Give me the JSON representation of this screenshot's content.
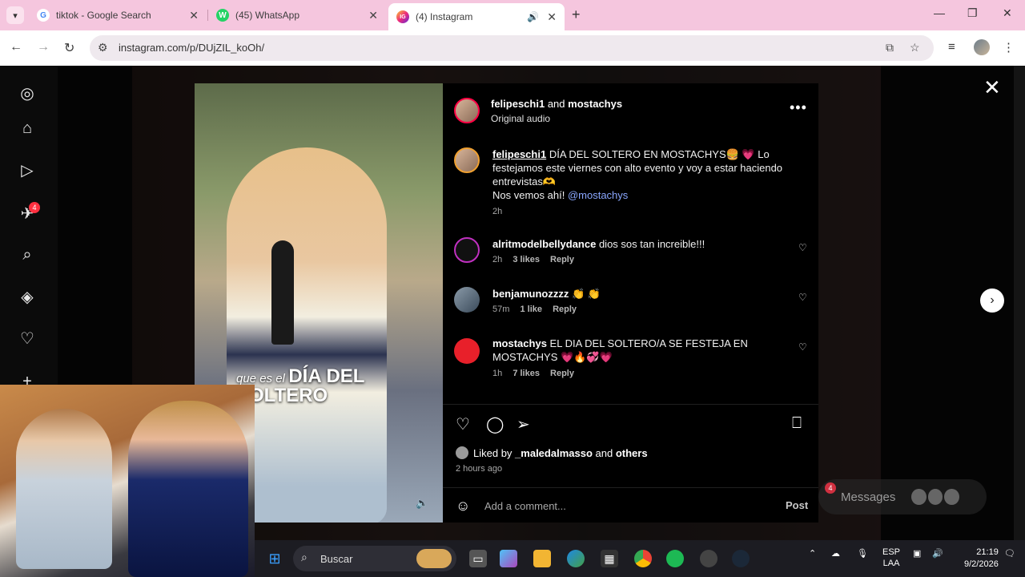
{
  "browser": {
    "tabs": [
      {
        "title": "tiktok - Google Search",
        "favicon": "G"
      },
      {
        "title": "(45) WhatsApp",
        "favicon": "W"
      },
      {
        "title": "(4) Instagram",
        "favicon": "IG"
      }
    ],
    "url": "instagram.com/p/DUjZIL_koOh/"
  },
  "sidebar": {
    "notifications_badge": "4"
  },
  "media": {
    "overlay_small": "que es el",
    "overlay_big_1": "DÍA DEL",
    "overlay_big_2": "SOLTERO"
  },
  "post": {
    "author": "felipeschi1",
    "and": "and",
    "collaborator": "mostachys",
    "audio": "Original audio",
    "caption": {
      "user": "felipeschi1",
      "text": "DÍA DEL SOLTERO EN MOSTACHYS🍔 💗 Lo festejamos este viernes con alto evento y voy a estar haciendo entrevistas🫶",
      "line2": "Nos vemos ahí!",
      "mention": "@mostachys",
      "time": "2h"
    },
    "comments": [
      {
        "user": "alritmodelbellydance",
        "text": "dios sos tan increible!!!",
        "time": "2h",
        "likes": "3 likes",
        "reply": "Reply"
      },
      {
        "user": "benjamunozzzz",
        "text": "👏 👏",
        "time": "57m",
        "likes": "1 like",
        "reply": "Reply"
      },
      {
        "user": "mostachys",
        "text": "EL DIA DEL SOLTERO/A SE FESTEJA EN MOSTACHYS 💗🔥💞💗",
        "time": "1h",
        "likes": "7 likes",
        "reply": "Reply"
      }
    ],
    "liked_by_prefix": "Liked by",
    "liked_by_user": "_maledalmasso",
    "liked_by_and": "and",
    "liked_by_others": "others",
    "time_ago": "2 hours ago",
    "add_comment_placeholder": "Add a comment...",
    "post_label": "Post"
  },
  "messages": {
    "label": "Messages",
    "badge": "4"
  },
  "taskbar": {
    "search_label": "Buscar",
    "lang": "ESP",
    "layout": "LAA",
    "time": "21:19",
    "date": "9/2/2026"
  }
}
